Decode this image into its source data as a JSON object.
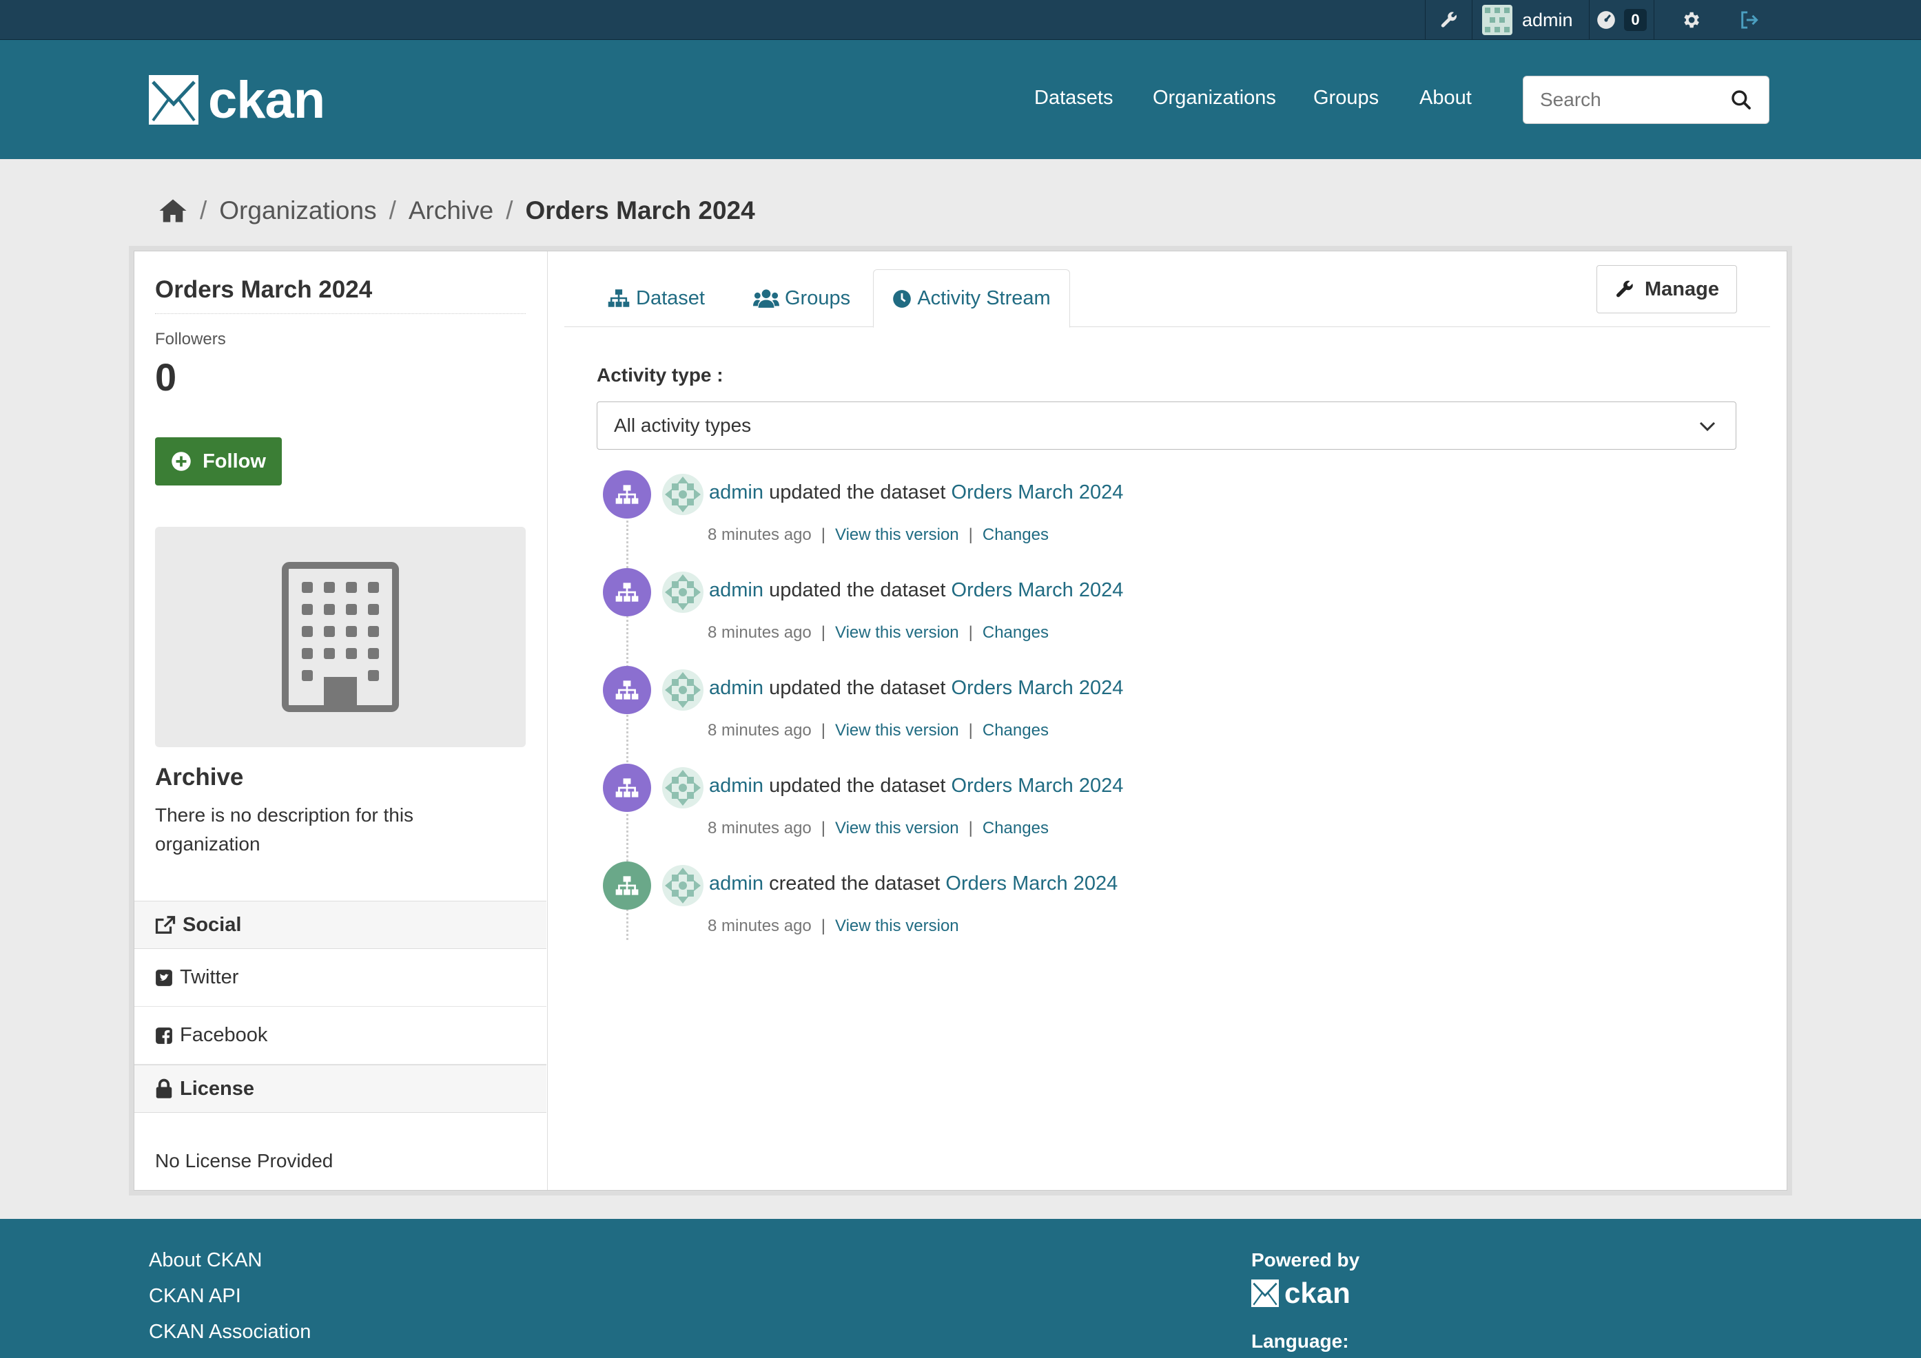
{
  "topbar": {
    "username": "admin",
    "notification_count": "0"
  },
  "header": {
    "logo_text": "ckan",
    "nav": [
      "Datasets",
      "Organizations",
      "Groups",
      "About"
    ],
    "search_placeholder": "Search"
  },
  "breadcrumb": {
    "items": [
      "Organizations",
      "Archive"
    ],
    "current": "Orders March 2024",
    "separator": "/"
  },
  "sidebar": {
    "title": "Orders March 2024",
    "followers_label": "Followers",
    "followers_count": "0",
    "follow_button": "Follow",
    "org_name": "Archive",
    "org_description": "There is no description for this organization",
    "social_heading": "Social",
    "social_links": [
      "Twitter",
      "Facebook"
    ],
    "license_heading": "License",
    "license_text": "No License Provided"
  },
  "tabs": [
    "Dataset",
    "Groups",
    "Activity Stream"
  ],
  "manage_button": "Manage",
  "activity": {
    "filter_label": "Activity type :",
    "filter_value": "All activity types",
    "items": [
      {
        "actor": "admin",
        "action": "updated the dataset",
        "target": "Orders March 2024",
        "time": "8 minutes ago",
        "view": "View this version",
        "changes": "Changes",
        "color": "#8b6fd0"
      },
      {
        "actor": "admin",
        "action": "updated the dataset",
        "target": "Orders March 2024",
        "time": "8 minutes ago",
        "view": "View this version",
        "changes": "Changes",
        "color": "#8b6fd0"
      },
      {
        "actor": "admin",
        "action": "updated the dataset",
        "target": "Orders March 2024",
        "time": "8 minutes ago",
        "view": "View this version",
        "changes": "Changes",
        "color": "#8b6fd0"
      },
      {
        "actor": "admin",
        "action": "updated the dataset",
        "target": "Orders March 2024",
        "time": "8 minutes ago",
        "view": "View this version",
        "changes": "Changes",
        "color": "#8b6fd0"
      },
      {
        "actor": "admin",
        "action": "created the dataset",
        "target": "Orders March 2024",
        "time": "8 minutes ago",
        "view": "View this version",
        "changes": "",
        "color": "#6aa889"
      }
    ]
  },
  "footer": {
    "links": [
      "About CKAN",
      "CKAN API",
      "CKAN Association"
    ],
    "powered_by": "Powered by",
    "powered_logo": "ckan",
    "language_label": "Language:"
  },
  "colors": {
    "brand": "#206b82",
    "topbar": "#1d4157",
    "follow_green": "#3b7e35",
    "link": "#206b82"
  },
  "icons": [
    "wrench-icon",
    "avatar",
    "dashboard-icon",
    "gear-icon",
    "logout-icon",
    "search-icon",
    "home-icon",
    "sitemap-icon",
    "users-icon",
    "clock-icon",
    "building-icon",
    "share-icon",
    "twitter-icon",
    "facebook-icon",
    "lock-icon",
    "plus-circle-icon",
    "chevron-down-icon"
  ]
}
